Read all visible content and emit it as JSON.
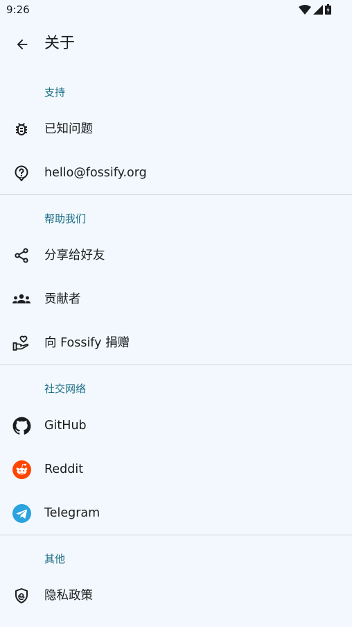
{
  "status": {
    "time": "9:26"
  },
  "appbar": {
    "title": "关于"
  },
  "sections": {
    "support": {
      "header": "支持",
      "known_issues": "已知问题",
      "email": "hello@fossify.org"
    },
    "help": {
      "header": "帮助我们",
      "share": "分享给好友",
      "contributors": "贡献者",
      "donate": "向 Fossify 捐赠"
    },
    "social": {
      "header": "社交网络",
      "github": "GitHub",
      "reddit": "Reddit",
      "telegram": "Telegram"
    },
    "other": {
      "header": "其他",
      "privacy": "隐私政策"
    }
  },
  "colors": {
    "background": "#f2f8fd",
    "section_header": "#1a6d86",
    "reddit": "#ff4500",
    "telegram": "#2aa3de"
  },
  "icons": [
    "back-arrow-icon",
    "bug-icon",
    "help-circle-icon",
    "share-icon",
    "contributors-icon",
    "donate-hand-heart-icon",
    "github-icon",
    "reddit-icon",
    "telegram-icon",
    "privacy-shield-icon"
  ]
}
